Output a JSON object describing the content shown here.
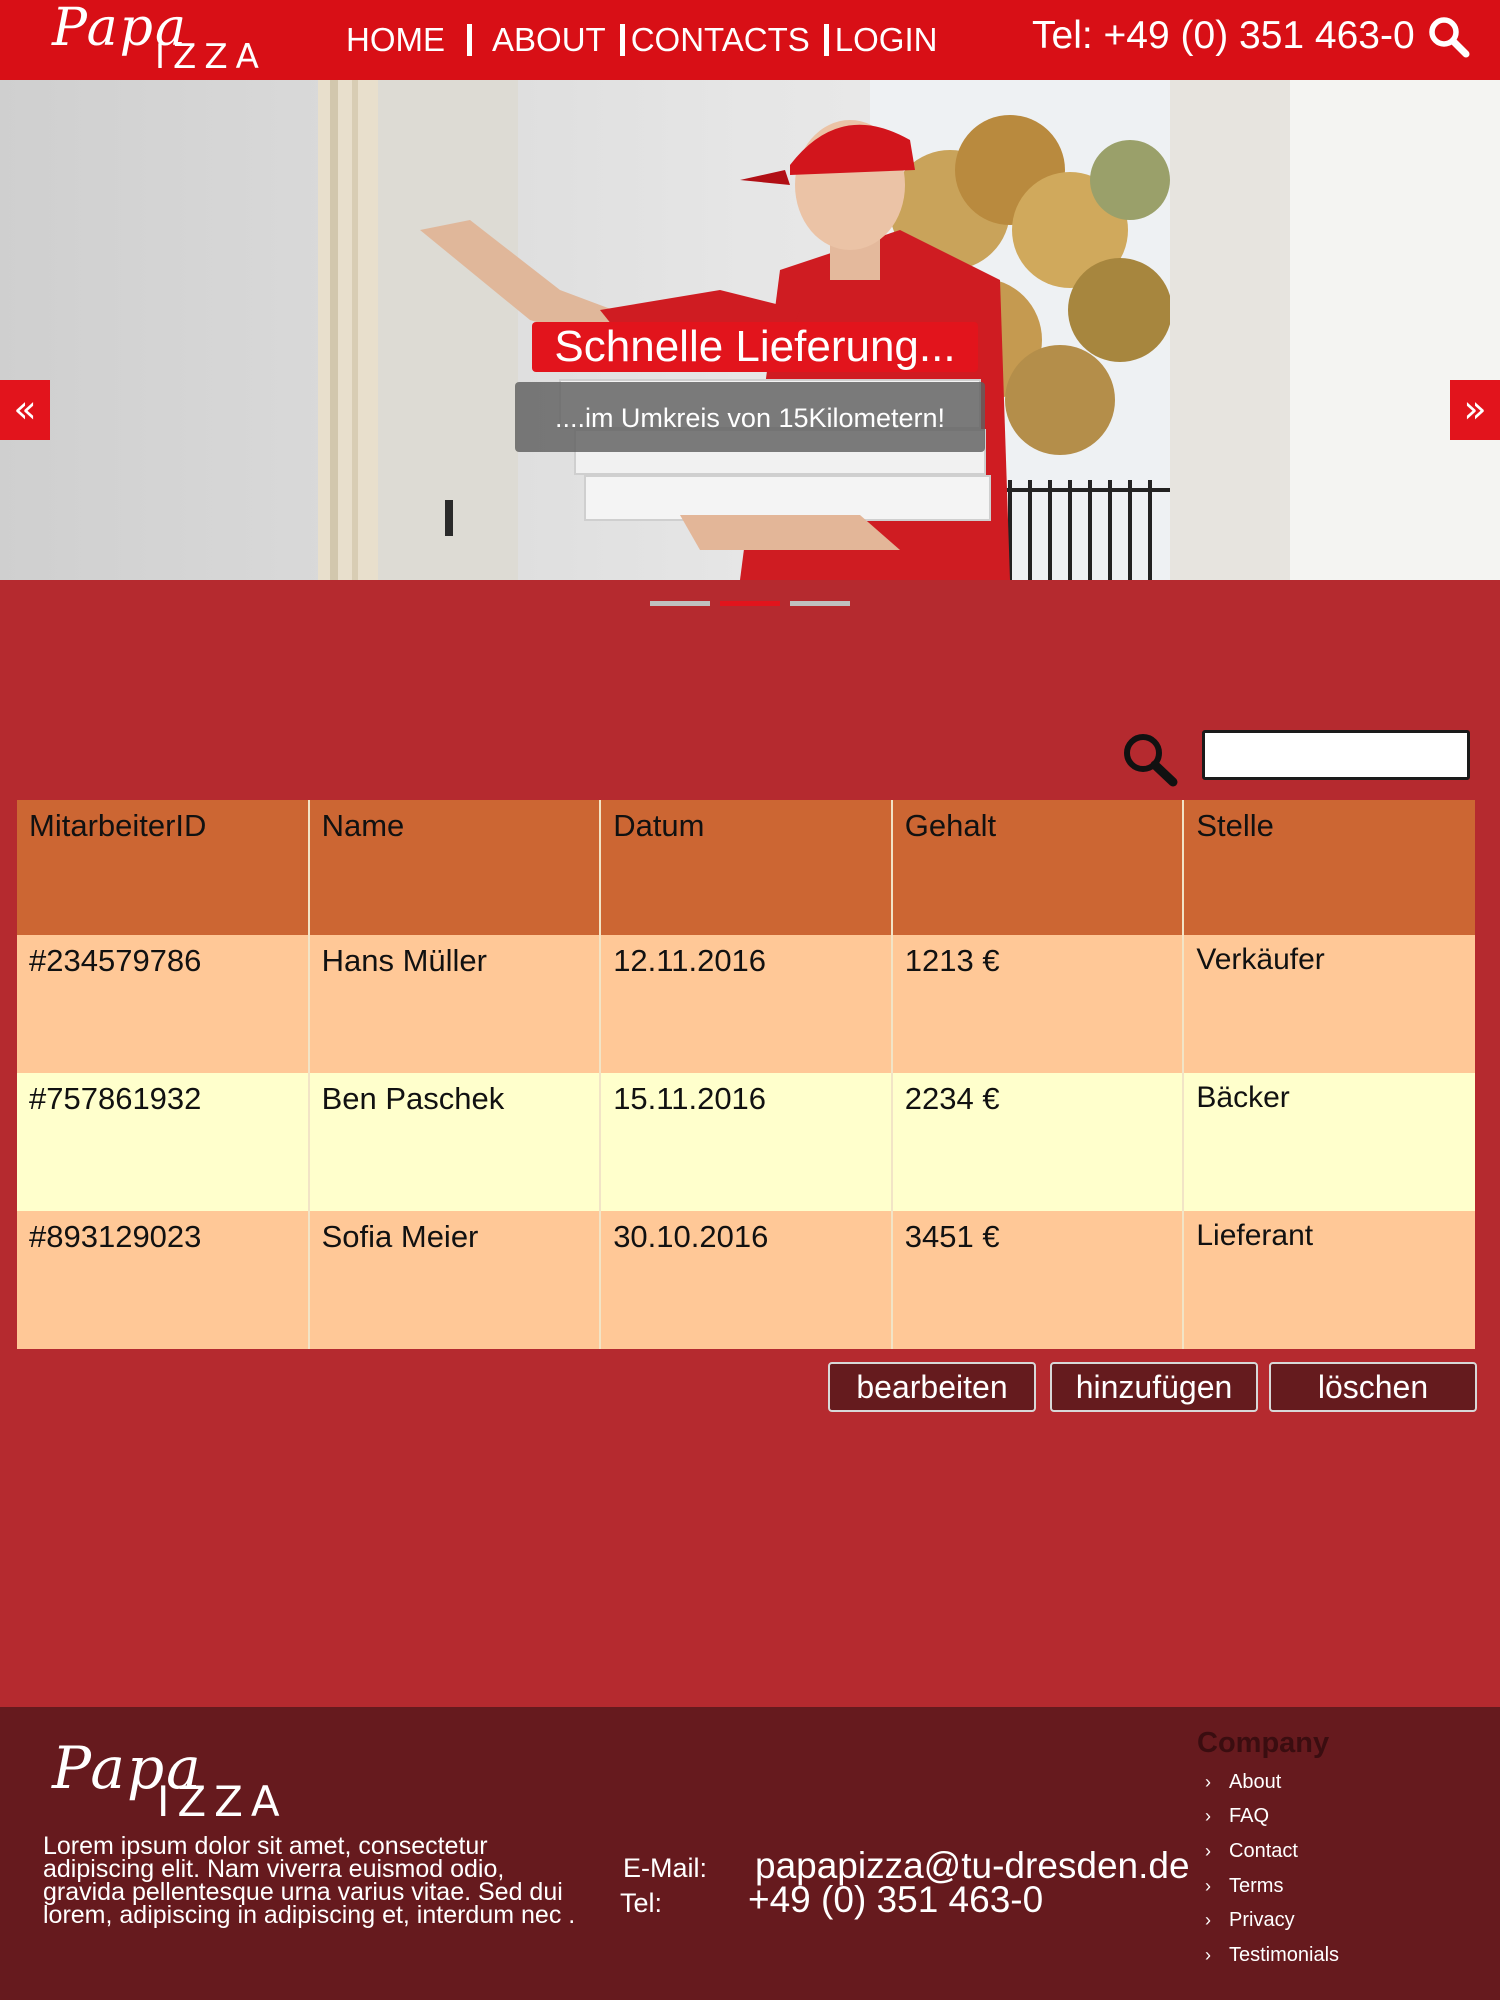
{
  "brand": {
    "name_top": "Papa",
    "name_bottom": "IZZA"
  },
  "nav": {
    "items": [
      {
        "label": "HOME"
      },
      {
        "label": "ABOUT"
      },
      {
        "label": "CONTACTS"
      },
      {
        "label": "LOGIN"
      }
    ]
  },
  "header": {
    "phone": "Tel: +49 (0) 351 463-0",
    "search_icon": "search-icon"
  },
  "slider": {
    "title": "Schnelle Lieferung...",
    "subtitle": "....im Umkreis von  15Kilometern!",
    "prev_label": "«",
    "next_label": "»",
    "slide_count": 3,
    "active_slide": 2
  },
  "search": {
    "placeholder": "",
    "value": ""
  },
  "table": {
    "columns": [
      "MitarbeiterID",
      "Name",
      "Datum",
      "Gehalt",
      "Stelle"
    ],
    "rows": [
      [
        "#234579786",
        "Hans Müller",
        "12.11.2016",
        "1213 €",
        "Verkäufer"
      ],
      [
        "#757861932",
        "Ben Paschek",
        "15.11.2016",
        "2234 €",
        "Bäcker"
      ],
      [
        "#893129023",
        "Sofia Meier",
        "30.10.2016",
        "3451 €",
        "Lieferant"
      ]
    ]
  },
  "actions": {
    "edit": "bearbeiten",
    "add": "hinzufügen",
    "delete": "löschen"
  },
  "footer": {
    "text": "Lorem ipsum dolor sit amet, consectetur adipiscing elit. Nam viverra euismod odio, gravida pellentesque urna varius vitae. Sed dui lorem, adipiscing in adipiscing et, interdum nec .",
    "email_label": "E-Mail:",
    "email": "papapizza@tu-dresden.de",
    "tel_label": "Tel:",
    "tel": "+49 (0) 351 463-0",
    "company_heading": "Company",
    "company_links": [
      "About",
      "FAQ",
      "Contact",
      "Terms",
      "Privacy",
      "Testimonials"
    ]
  },
  "colors": {
    "header_red": "#d80f16",
    "page_bg": "#b52a2f",
    "table_header": "#cc6633",
    "row_peach": "#ffc897",
    "row_cream": "#ffffcc",
    "button_bg": "#651b1e",
    "footer_bg": "#661a1e"
  }
}
